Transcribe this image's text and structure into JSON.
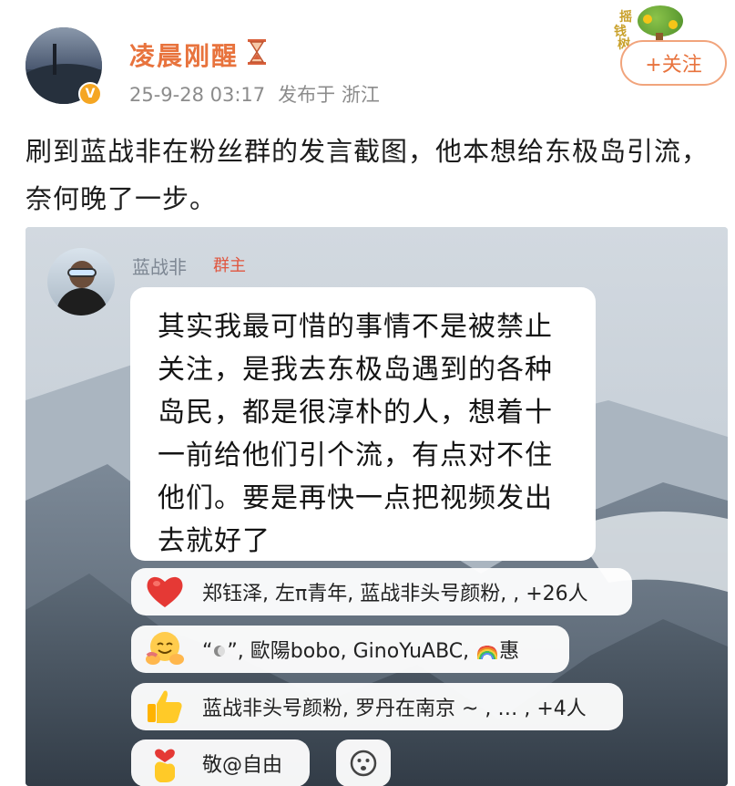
{
  "post": {
    "username": "凌晨刚醒",
    "timestamp": "25-9-28 03:17",
    "location": "发布于 浙江",
    "follow_label": "+关注",
    "badge_text": "V",
    "tree_badge_chars": [
      "摇",
      "钱",
      "树"
    ],
    "text": "刷到蓝战非在粉丝群的发言截图，他本想给东极岛引流，奈何晚了一步。"
  },
  "screenshot": {
    "sender_name": "蓝战非",
    "sender_role": "群主",
    "message": "其实我最可惜的事情不是被禁止关注，是我去东极岛遇到的各种岛民，都是很淳朴的人，想着十一前给他们引个流，有点对不住他们。要是再快一点把视频发出去就好了",
    "reactions": [
      {
        "icon": "red-heart-icon",
        "text": "郑钰泽, 左π青年, 蓝战非头号颜粉, , +26人"
      },
      {
        "icon": "hugging-face-icon",
        "text_prefix": "“",
        "text_middle": "”, 歐陽bobo, GinoYuABC, ",
        "text_suffix": "惠"
      },
      {
        "icon": "thumbs-up-icon",
        "text": "蓝战非头号颜粉, 罗丹在南京 ~ , … , +4人"
      },
      {
        "icon": "finger-heart-icon",
        "text": "敬@自由"
      }
    ]
  },
  "colors": {
    "accent": "#e8733d",
    "follow_border": "#f1a47c",
    "meta_gray": "#8c8c8c",
    "role_red": "#e0563f"
  }
}
